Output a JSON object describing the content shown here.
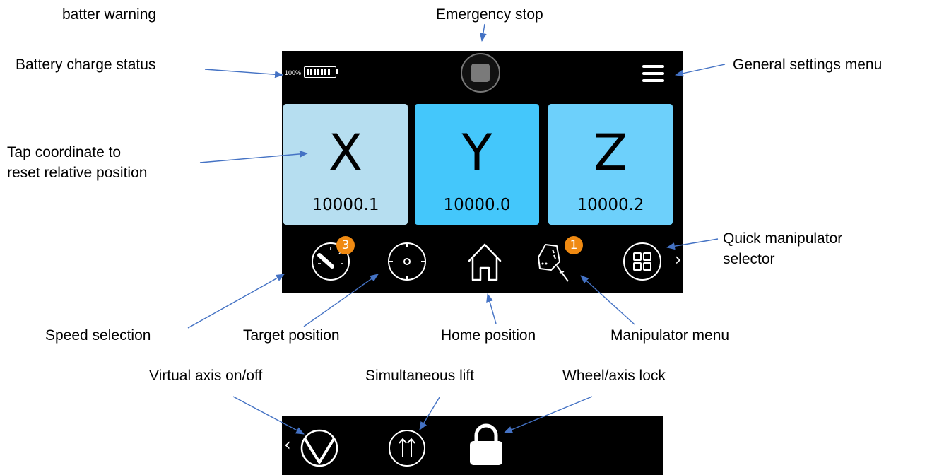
{
  "annotations": {
    "battery_warning": "batter warning",
    "emergency_stop": "Emergency stop",
    "battery_status": "Battery charge status",
    "general_settings": "General settings menu",
    "tap_coord_line1": "Tap coordinate to",
    "tap_coord_line2": "reset relative position",
    "quick_manip_line1": "Quick manipulator",
    "quick_manip_line2": "selector",
    "speed_selection": "Speed selection",
    "target_position": "Target position",
    "home_position": "Home position",
    "manipulator_menu": "Manipulator menu",
    "virtual_axis": "Virtual axis on/off",
    "simultaneous_lift": "Simultaneous lift",
    "wheel_axis_lock": "Wheel/axis lock"
  },
  "device": {
    "battery_percent": "100%",
    "battery_level": 1.0,
    "axes": [
      {
        "label": "X",
        "value": "10000.1",
        "color": "#b6def0"
      },
      {
        "label": "Y",
        "value": "10000.0",
        "color": "#44c7fb"
      },
      {
        "label": "Z",
        "value": "10000.2",
        "color": "#6dd0fb"
      }
    ],
    "speed_badge": "3",
    "manipulator_badge": "1",
    "next_page": "›",
    "prev_page": "‹"
  },
  "colors": {
    "screen_bg": "#000000",
    "badge": "#f08a12",
    "arrow": "#4472c4"
  },
  "icons": [
    "battery-icon",
    "emergency-stop-icon",
    "menu-icon",
    "speedometer-icon",
    "target-icon",
    "home-icon",
    "manipulator-icon",
    "grid-icon",
    "virtual-axis-icon",
    "simultaneous-lift-icon",
    "lock-icon"
  ]
}
